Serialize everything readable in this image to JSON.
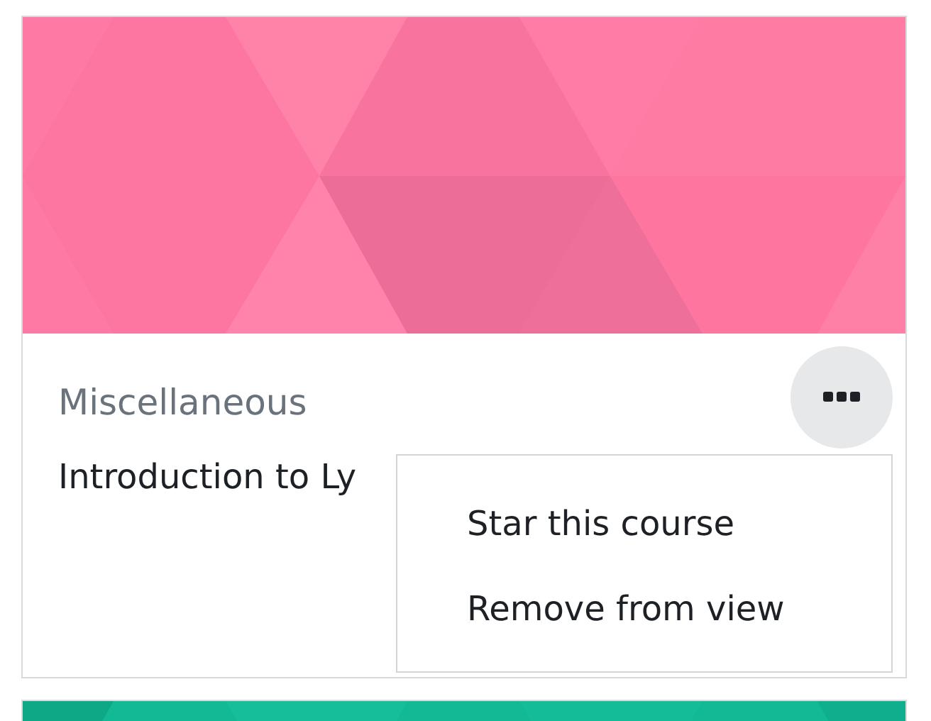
{
  "cards": [
    {
      "kind": "course",
      "category": "Miscellaneous",
      "title": "Introduction to Ly",
      "menu": {
        "expanded": true,
        "items": [
          "Star this course",
          "Remove from view"
        ]
      }
    },
    {
      "kind": "cut_off"
    }
  ]
}
